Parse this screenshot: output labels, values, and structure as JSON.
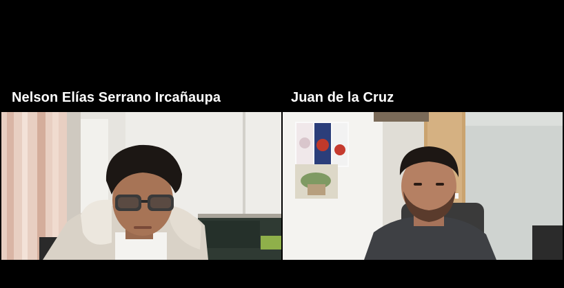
{
  "participants": [
    {
      "name": "Nelson Elías Serrano Ircañaupa"
    },
    {
      "name": "Juan de la Cruz"
    }
  ],
  "colors": {
    "background": "#000000",
    "label_text": "#ffffff"
  }
}
